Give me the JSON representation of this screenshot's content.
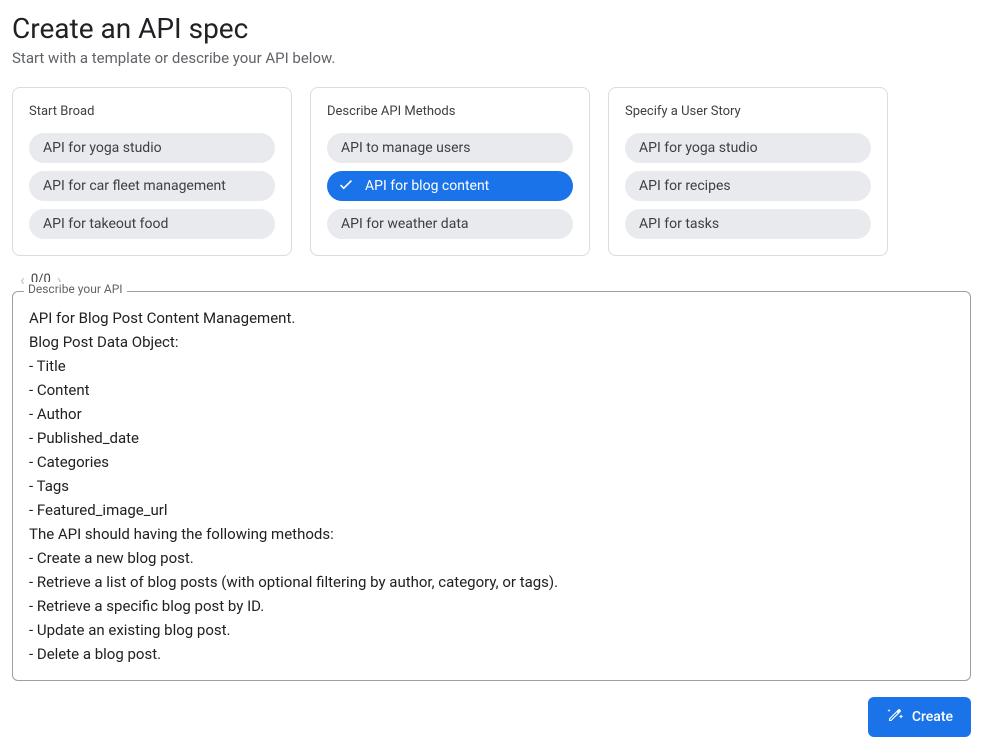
{
  "header": {
    "title": "Create an API spec",
    "subtitle": "Start with a template or describe your API below."
  },
  "cards": [
    {
      "title": "Start Broad",
      "chips": [
        {
          "label": "API for yoga studio",
          "selected": false
        },
        {
          "label": "API for car fleet management",
          "selected": false
        },
        {
          "label": "API for takeout food",
          "selected": false
        }
      ]
    },
    {
      "title": "Describe API Methods",
      "chips": [
        {
          "label": "API to manage users",
          "selected": false
        },
        {
          "label": "API for blog content",
          "selected": true
        },
        {
          "label": "API for weather data",
          "selected": false
        }
      ]
    },
    {
      "title": "Specify a User Story",
      "chips": [
        {
          "label": "API for yoga studio",
          "selected": false
        },
        {
          "label": "API for recipes",
          "selected": false
        },
        {
          "label": "API for tasks",
          "selected": false
        }
      ]
    }
  ],
  "pager": {
    "text": "0/0"
  },
  "describe": {
    "legend": "Describe your API",
    "content": "API for Blog Post Content Management.\nBlog Post Data Object:\n- Title\n- Content\n- Author\n- Published_date\n- Categories\n- Tags\n- Featured_image_url\nThe API should having the following methods:\n- Create a new blog post.\n- Retrieve a list of blog posts (with optional filtering by author, category, or tags).\n- Retrieve a specific blog post by ID.\n- Update an existing blog post.\n- Delete a blog post."
  },
  "footer": {
    "create_label": "Create"
  }
}
